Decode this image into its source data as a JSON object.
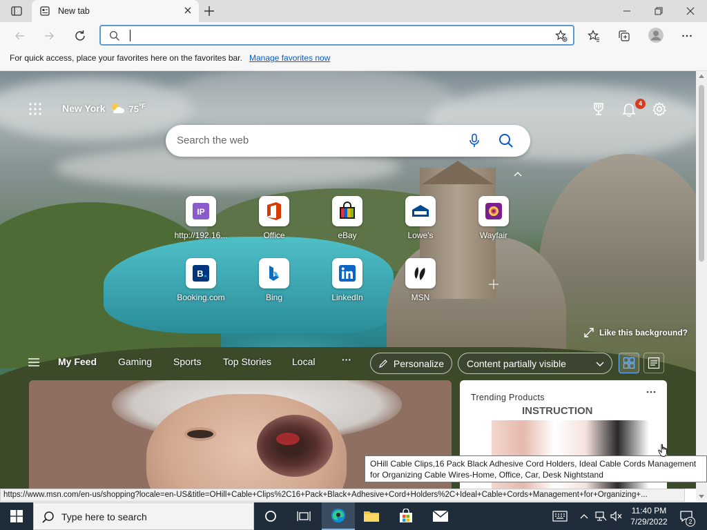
{
  "browser": {
    "tab_title": "New tab",
    "address_value": "",
    "favorites_bar_message": "For quick access, place your favorites here on the favorites bar.",
    "favorites_bar_link": "Manage favorites now"
  },
  "newtab": {
    "location": "New York",
    "temperature": "75",
    "temperature_unit": "°F",
    "notification_count": "4",
    "search_placeholder": "Search the web",
    "quick_links": [
      {
        "label": "http://192.16...",
        "icon": "ip-icon",
        "color": "#8b5cc9"
      },
      {
        "label": "Office",
        "icon": "office-icon",
        "color": "#d83b01"
      },
      {
        "label": "eBay",
        "icon": "ebay-icon",
        "color": "#1b1b1b"
      },
      {
        "label": "Lowe's",
        "icon": "lowes-icon",
        "color": "#004990"
      },
      {
        "label": "Wayfair",
        "icon": "wayfair-icon",
        "color": "#7b1f8c"
      },
      {
        "label": "Booking.com",
        "icon": "booking-icon",
        "color": "#003580"
      },
      {
        "label": "Bing",
        "icon": "bing-icon",
        "color": "#0f6cbd"
      },
      {
        "label": "LinkedIn",
        "icon": "linkedin-icon",
        "color": "#0a66c2"
      },
      {
        "label": "MSN",
        "icon": "msn-icon",
        "color": "#1b1b1b"
      }
    ],
    "like_background": "Like this background?",
    "feed_nav": [
      "My Feed",
      "Gaming",
      "Sports",
      "Top Stories",
      "Local"
    ],
    "more_label": "···",
    "personalize_label": "Personalize",
    "content_visibility": "Content partially visible",
    "trending_title": "Trending Products",
    "trending_image_text": "INSTRUCTION"
  },
  "tooltip": "OHill Cable Clips,16 Pack Black Adhesive Cord Holders, Ideal Cable Cords Management for Organizing Cable Wires-Home, Office, Car, Desk Nightstand",
  "status_url": "https://www.msn.com/en-us/shopping?locale=en-US&title=OHill+Cable+Clips%2C16+Pack+Black+Adhesive+Cord+Holders%2C+Ideal+Cable+Cords+Management+for+Organizing+...",
  "taskbar": {
    "search_placeholder": "Type here to search",
    "time": "11:40 PM",
    "date": "7/29/2022",
    "notification_count": "2"
  }
}
